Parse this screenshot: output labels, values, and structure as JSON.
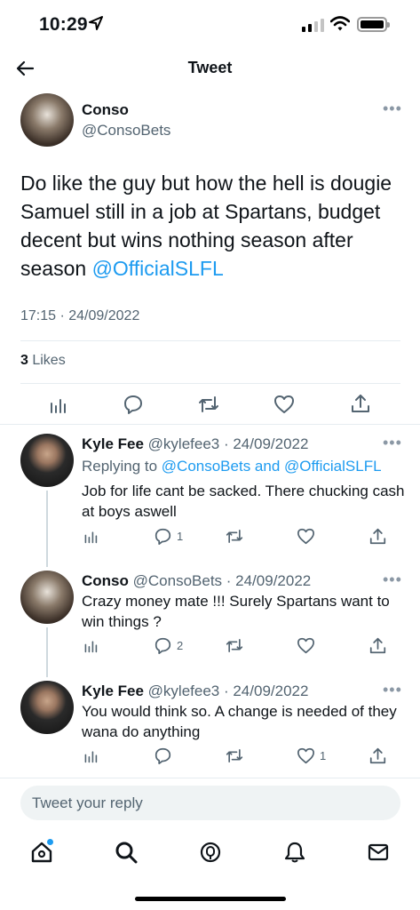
{
  "status_bar": {
    "time": "10:29"
  },
  "nav": {
    "title": "Tweet"
  },
  "main_tweet": {
    "name": "Conso",
    "handle": "@ConsoBets",
    "text": "Do like the guy but how the hell is dougie Samuel still in a job at Spartans, budget decent but wins nothing season after season ",
    "mention": "@OfficialSLFL",
    "timestamp": "17:15 · 24/09/2022",
    "likes_count": "3",
    "likes_label": " Likes"
  },
  "replies": [
    {
      "name": "Kyle Fee",
      "handle": "@kylefee3 · 24/09/2022",
      "replying_prefix": "Replying to ",
      "replying_mentions": "@ConsoBets and @OfficialSLFL",
      "text": "Job for life cant be sacked. There chucking cash at boys aswell",
      "reply_count": "1",
      "like_count": ""
    },
    {
      "name": "Conso",
      "handle": "@ConsoBets · 24/09/2022",
      "text": "Crazy money mate !!! Surely Spartans want to win things ?",
      "reply_count": "2",
      "like_count": ""
    },
    {
      "name": "Kyle Fee",
      "handle": "@kylefee3 · 24/09/2022",
      "text": "You would think so. A change is needed of they wana do anything",
      "reply_count": "",
      "like_count": "1"
    }
  ],
  "reply_box": {
    "placeholder": "Tweet your reply"
  },
  "colors": {
    "accent": "#1d9bf0",
    "muted": "#536471"
  },
  "icons": [
    "back-arrow-icon",
    "more-icon",
    "analytics-icon",
    "reply-icon",
    "retweet-icon",
    "like-icon",
    "share-icon",
    "home-icon",
    "search-icon",
    "spaces-icon",
    "notifications-icon",
    "messages-icon"
  ]
}
